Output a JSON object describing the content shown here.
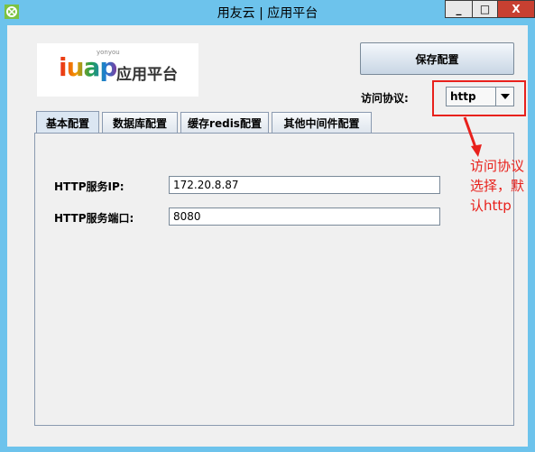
{
  "window": {
    "title": "用友云 | 应用平台",
    "min_label": "_",
    "max_label": "□",
    "close_label": "X"
  },
  "logo": {
    "brand": "iuap",
    "brand_small": "yonyou",
    "brand_cn": "应用平台"
  },
  "toolbar": {
    "save_label": "保存配置",
    "protocol_label": "访问协议:",
    "protocol_value": "http"
  },
  "tabs": [
    {
      "label": "基本配置",
      "active": true
    },
    {
      "label": "数据库配置",
      "active": false
    },
    {
      "label": "缓存redis配置",
      "active": false
    },
    {
      "label": "其他中间件配置",
      "active": false
    }
  ],
  "form": {
    "ip_label": "HTTP服务IP:",
    "ip_value": "172.20.8.87",
    "port_label": "HTTP服务端口:",
    "port_value": "8080"
  },
  "annotation": {
    "line1": "访问协议",
    "line2": "选择，默",
    "line3": "认http"
  },
  "colors": {
    "titlebar": "#6dc3ec",
    "close": "#c84031",
    "annotation_red": "#e8211c"
  }
}
